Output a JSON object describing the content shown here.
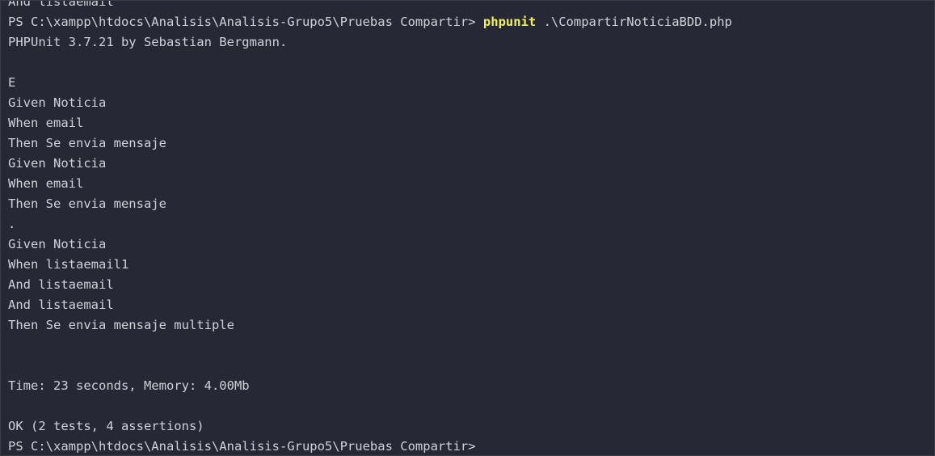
{
  "terminal": {
    "top_partial_line": "And listaemail",
    "command_line": {
      "prompt": "PS C:\\xampp\\htdocs\\Analisis\\Analisis-Grupo5\\Pruebas Compartir> ",
      "command": "phpunit",
      "args": " .\\CompartirNoticiaBDD.php"
    },
    "phpunit_banner": "PHPUnit 3.7.21 by Sebastian Bergmann.",
    "output": {
      "result_E": "E",
      "step_1": "Given Noticia",
      "step_2": "When email",
      "step_3": "Then Se envia mensaje",
      "step_4": "Given Noticia",
      "step_5": "When email",
      "step_6": "Then Se envia mensaje",
      "result_dot": ".",
      "step_7": "Given Noticia",
      "step_8": "When listaemail1",
      "step_9": "And listaemail",
      "step_10": "And listaemail",
      "step_11": "Then Se envia mensaje multiple"
    },
    "time_memory": "Time: 23 seconds, Memory: 4.00Mb",
    "summary": "OK (2 tests, 4 assertions)",
    "final_prompt": "PS C:\\xampp\\htdocs\\Analisis\\Analisis-Grupo5\\Pruebas Compartir>"
  },
  "colors": {
    "background": "#262935",
    "text": "#cfd2d8",
    "command_highlight": "#f2f05a"
  }
}
